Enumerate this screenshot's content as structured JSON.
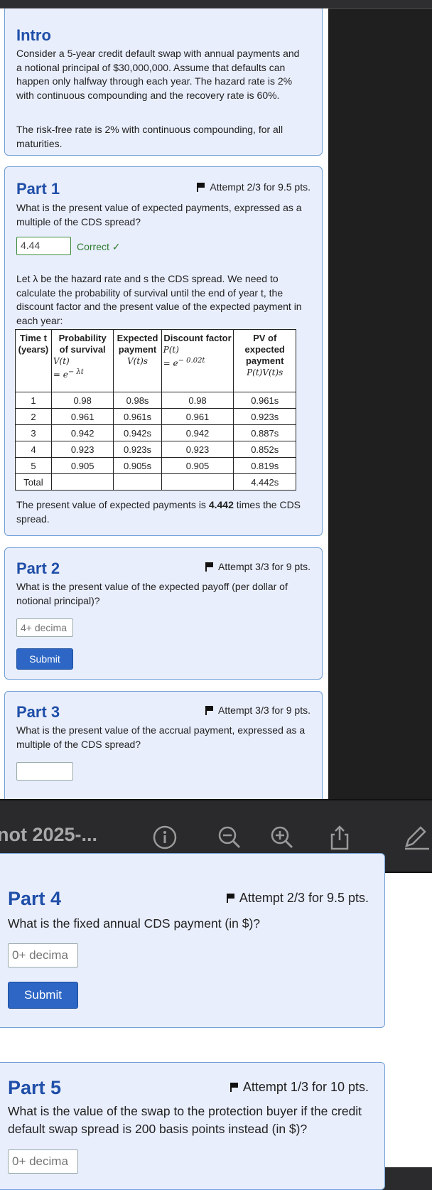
{
  "intro": {
    "title": "Intro",
    "p1": "Consider a 5-year credit default swap with annual payments and a notional principal of $30,000,000. Assume that defaults can happen only halfway through each year. The hazard rate is 2% with continuous compounding and the recovery rate is 60%.",
    "p2": "The risk-free rate is 2% with continuous compounding, for all maturities."
  },
  "part1": {
    "title": "Part 1",
    "attempt": "Attempt 2/3 for 9.5 pts.",
    "question": "What is the present value of expected payments, expressed as a multiple of the CDS spread?",
    "answer": "4.44",
    "status": "Correct ✓",
    "explain": "Let λ be the hazard rate and s the CDS spread. We need to calculate the probability of survival until the end of year t, the discount factor and the present value of the expected payment in each year:",
    "table": {
      "headers": {
        "time": "Time t (years)",
        "prob": "Probability of survival",
        "prob_m1": "V(t)",
        "prob_m2": "= e",
        "prob_m3": "− λt",
        "exp": "Expected payment",
        "exp_m": "V(t)s",
        "disc": "Discount factor",
        "disc_m1": "P(t)",
        "disc_m2": "= e",
        "disc_m3": "− 0.02t",
        "pv": "PV of expected payment",
        "pv_m": "P(t)V(t)s"
      },
      "rows": [
        [
          "1",
          "0.98",
          "0.98s",
          "0.98",
          "0.961s"
        ],
        [
          "2",
          "0.961",
          "0.961s",
          "0.961",
          "0.923s"
        ],
        [
          "3",
          "0.942",
          "0.942s",
          "0.942",
          "0.887s"
        ],
        [
          "4",
          "0.923",
          "0.923s",
          "0.923",
          "0.852s"
        ],
        [
          "5",
          "0.905",
          "0.905s",
          "0.905",
          "0.819s"
        ]
      ],
      "total_label": "Total",
      "total_value": "4.442s"
    },
    "conclusion_pre": "The present value of expected payments is ",
    "conclusion_bold": "4.442",
    "conclusion_post": " times the CDS spread."
  },
  "part2": {
    "title": "Part 2",
    "attempt": "Attempt 3/3 for 9 pts.",
    "question": "What is the present value of the expected payoff (per dollar of notional principal)?",
    "placeholder": "4+ decima",
    "submit": "Submit"
  },
  "part3": {
    "title": "Part 3",
    "attempt": "Attempt 3/3 for 9 pts.",
    "question": "What is the present value of the accrual payment, expressed as a multiple of the CDS spread?"
  },
  "toolbar": {
    "title": "not 2025-..."
  },
  "part4": {
    "title": "Part 4",
    "attempt": "Attempt 2/3 for 9.5 pts.",
    "question": "What is the fixed annual CDS payment (in $)?",
    "placeholder": "0+ decima",
    "submit": "Submit"
  },
  "part5": {
    "title": "Part 5",
    "attempt": "Attempt 1/3 for 10 pts.",
    "question": "What is the value of the swap to the protection buyer if the credit default swap spread is 200 basis points instead (in $)?",
    "placeholder": "0+ decima"
  }
}
